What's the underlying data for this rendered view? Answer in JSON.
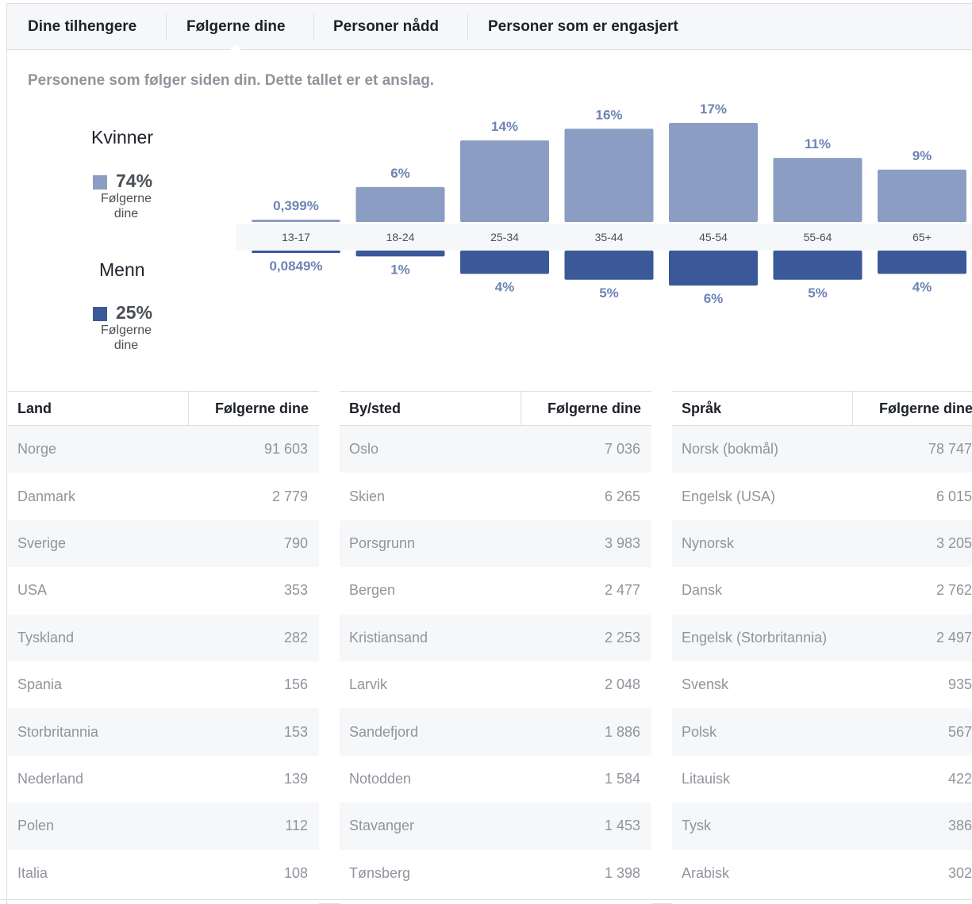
{
  "tabs": [
    {
      "label": "Dine tilhengere"
    },
    {
      "label": "Følgerne dine"
    },
    {
      "label": "Personer nådd"
    },
    {
      "label": "Personer som er engasjert"
    }
  ],
  "subtitle": "Personene som følger siden din. Dette tallet er et anslag.",
  "legend": {
    "women": {
      "title": "Kvinner",
      "percent": "74%",
      "label": "Følgerne dine",
      "color": "#8b9dc3"
    },
    "men": {
      "title": "Menn",
      "percent": "25%",
      "label": "Følgerne dine",
      "color": "#3b5998"
    }
  },
  "chart_data": {
    "type": "bar",
    "categories": [
      "13-17",
      "18-24",
      "25-34",
      "35-44",
      "45-54",
      "55-64",
      "65+"
    ],
    "series": [
      {
        "name": "Kvinner",
        "values": [
          0.399,
          6,
          14,
          16,
          17,
          11,
          9
        ],
        "labels": [
          "0,399%",
          "6%",
          "14%",
          "16%",
          "17%",
          "11%",
          "9%"
        ],
        "color": "#8b9dc3"
      },
      {
        "name": "Menn",
        "values": [
          0.0849,
          1,
          4,
          5,
          6,
          5,
          4
        ],
        "labels": [
          "0,0849%",
          "1%",
          "4%",
          "5%",
          "6%",
          "5%",
          "4%"
        ],
        "color": "#3b5998"
      }
    ]
  },
  "tables": [
    {
      "header": [
        "Land",
        "Følgerne dine"
      ],
      "rows": [
        [
          "Norge",
          "91 603"
        ],
        [
          "Danmark",
          "2 779"
        ],
        [
          "Sverige",
          "790"
        ],
        [
          "USA",
          "353"
        ],
        [
          "Tyskland",
          "282"
        ],
        [
          "Spania",
          "156"
        ],
        [
          "Storbritannia",
          "153"
        ],
        [
          "Nederland",
          "139"
        ],
        [
          "Polen",
          "112"
        ],
        [
          "Italia",
          "108"
        ]
      ]
    },
    {
      "header": [
        "By/sted",
        "Følgerne dine"
      ],
      "rows": [
        [
          "Oslo",
          "7 036"
        ],
        [
          "Skien",
          "6 265"
        ],
        [
          "Porsgrunn",
          "3 983"
        ],
        [
          "Bergen",
          "2 477"
        ],
        [
          "Kristiansand",
          "2 253"
        ],
        [
          "Larvik",
          "2 048"
        ],
        [
          "Sandefjord",
          "1 886"
        ],
        [
          "Notodden",
          "1 584"
        ],
        [
          "Stavanger",
          "1 453"
        ],
        [
          "Tønsberg",
          "1 398"
        ]
      ]
    },
    {
      "header": [
        "Språk",
        "Følgerne dine"
      ],
      "rows": [
        [
          "Norsk (bokmål)",
          "78 747"
        ],
        [
          "Engelsk (USA)",
          "6 015"
        ],
        [
          "Nynorsk",
          "3 205"
        ],
        [
          "Dansk",
          "2 762"
        ],
        [
          "Engelsk (Storbritannia)",
          "2 497"
        ],
        [
          "Svensk",
          "935"
        ],
        [
          "Polsk",
          "567"
        ],
        [
          "Litauisk",
          "422"
        ],
        [
          "Tysk",
          "386"
        ],
        [
          "Arabisk",
          "302"
        ]
      ]
    }
  ]
}
